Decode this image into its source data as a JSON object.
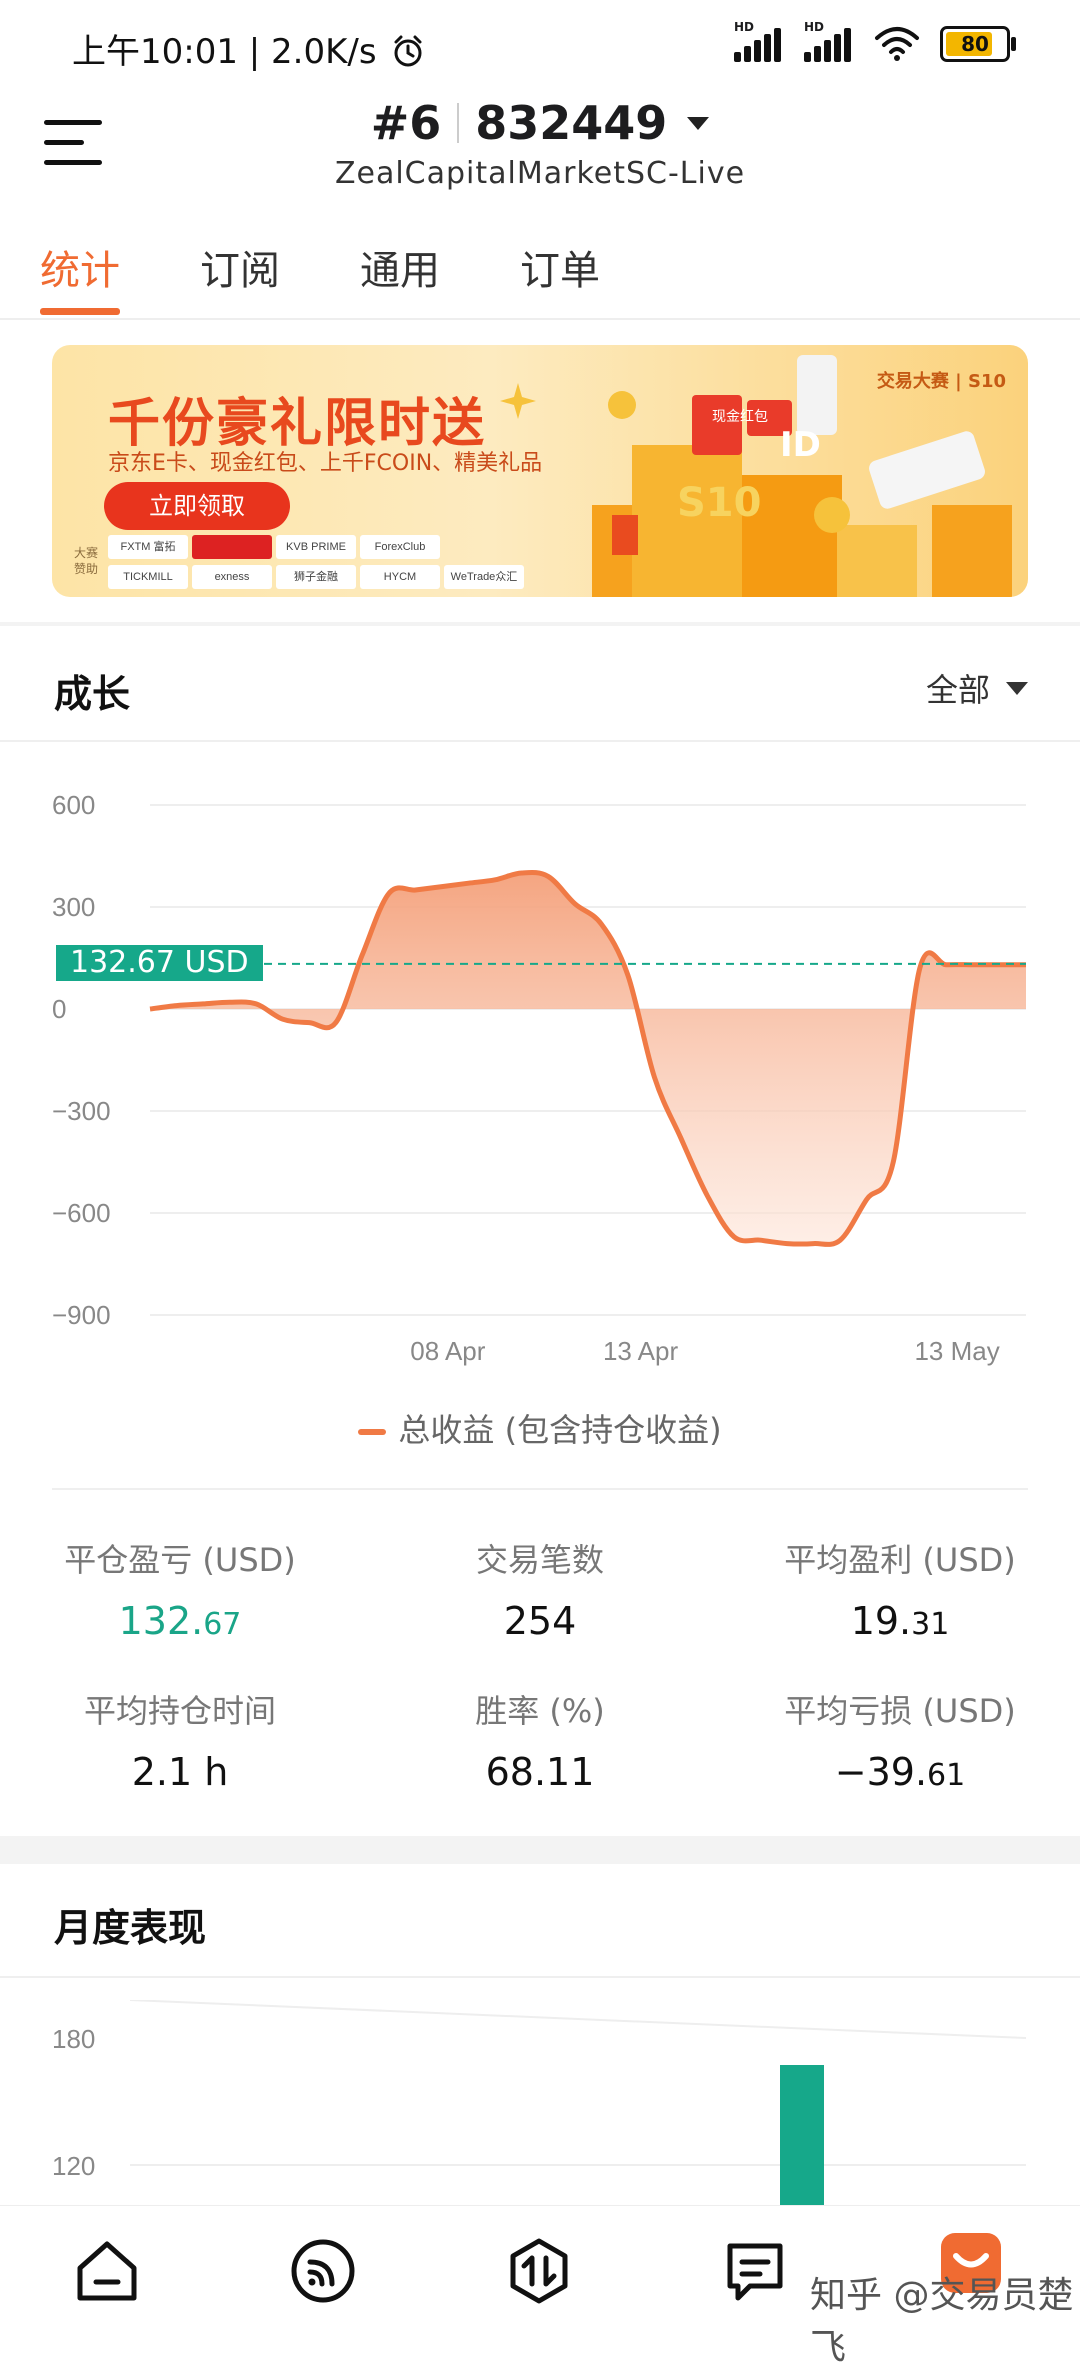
{
  "status_bar": {
    "time_speed": "上午10:01 | 2.0K/s",
    "battery": "80",
    "hd1": "HD",
    "hd2": "HD"
  },
  "header": {
    "account_index": "#6",
    "account_number": "832449",
    "server": "ZealCapitalMarketSC-Live"
  },
  "tabs": [
    {
      "label": "统计",
      "active": true
    },
    {
      "label": "订阅",
      "active": false
    },
    {
      "label": "通用",
      "active": false
    },
    {
      "label": "订单",
      "active": false
    }
  ],
  "banner": {
    "title": "千份豪礼限时送",
    "subtitle": "京东E卡、现金红包、上千FCOIN、精美礼品",
    "button": "立即领取",
    "brand": "交易大赛 | S10",
    "sponsor_label": "大赛赞助",
    "sponsors": [
      "FXTM 富拓",
      "",
      "KVB PRIME",
      "ForexClub",
      "",
      "TICKMILL",
      "exness",
      "狮子金融",
      "HYCM",
      "WeTrade众汇"
    ],
    "badge_id": "ID",
    "badge_s10": "S10",
    "badge_cash": "现金红包"
  },
  "growth": {
    "title": "成长",
    "filter": "全部",
    "current_label": "132.67 USD",
    "legend": "总收益 (包含持仓收益)"
  },
  "chart_data": {
    "type": "area",
    "ylim": [
      -900,
      600
    ],
    "y_ticks": [
      "600",
      "300",
      "0",
      "−300",
      "−600",
      "−900"
    ],
    "y_tick_values": [
      600,
      300,
      0,
      -300,
      -600,
      -900
    ],
    "x_tick_labels": [
      "08 Apr",
      "13 Apr",
      "13 May"
    ],
    "marker_value": 132.67,
    "series": [
      {
        "name": "总收益 (包含持仓收益)",
        "color": "#f07a45",
        "values": [
          0,
          10,
          15,
          20,
          15,
          -30,
          -40,
          -40,
          160,
          340,
          350,
          360,
          370,
          380,
          400,
          390,
          310,
          250,
          100,
          -200,
          -380,
          -550,
          -670,
          -680,
          -690,
          -690,
          -680,
          -560,
          -450,
          120,
          130,
          130,
          130,
          130
        ]
      }
    ]
  },
  "stats": [
    {
      "label": "平仓盈亏 (USD)",
      "int": "132.",
      "dec": "67",
      "green": true
    },
    {
      "label": "交易笔数",
      "int": "254",
      "dec": "",
      "green": false
    },
    {
      "label": "平均盈利 (USD)",
      "int": "19.",
      "dec": "31",
      "green": false
    },
    {
      "label": "平均持仓时间",
      "int": "2.1 h",
      "dec": "",
      "green": false
    },
    {
      "label": "胜率 (%)",
      "int": "68.11",
      "dec": "",
      "green": false
    },
    {
      "label": "平均亏损 (USD)",
      "int": "−39.",
      "dec": "61",
      "green": false
    }
  ],
  "monthly": {
    "title": "月度表现",
    "chart_data": {
      "type": "bar",
      "y_ticks": [
        "180",
        "120"
      ],
      "bar_color": "#16a88a",
      "bar_value_top": 170
    }
  },
  "bottom_nav": {
    "items": [
      "home-icon",
      "signal-icon",
      "trade-icon",
      "message-icon",
      "community-icon"
    ],
    "watermark": "知乎 @交易员楚飞"
  }
}
